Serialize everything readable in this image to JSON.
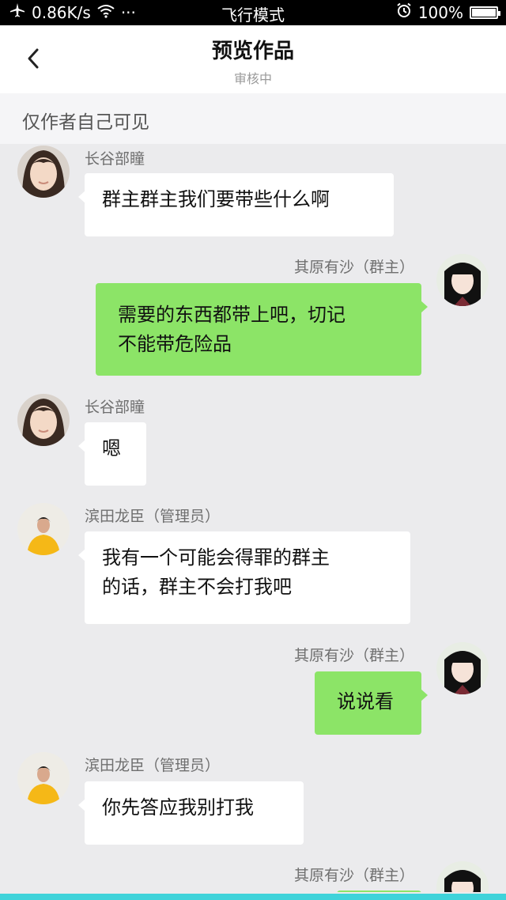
{
  "status_bar": {
    "speed": "0.86K/s",
    "dots": "···",
    "mode": "飞行模式",
    "battery": "100%",
    "battery_level": 1.0
  },
  "header": {
    "title": "预览作品",
    "subtitle": "审核中"
  },
  "notice": "仅作者自己可见",
  "messages": [
    {
      "side": "left",
      "sender": "长谷部瞳",
      "avatar": "woman-short-hair-avatar",
      "text": "群主群主我们要带些什么啊"
    },
    {
      "side": "right",
      "sender": "其原有沙（群主）",
      "avatar": "girl-black-hair-avatar",
      "text": "需要的东西都带上吧，切记\n不能带危险品"
    },
    {
      "side": "left",
      "sender": "长谷部瞳",
      "avatar": "woman-short-hair-avatar",
      "text": "嗯"
    },
    {
      "side": "left",
      "sender": "滨田龙臣（管理员）",
      "avatar": "man-yellow-shirt-avatar",
      "text": "我有一个可能会得罪的群主\n的话，群主不会打我吧"
    },
    {
      "side": "right",
      "sender": "其原有沙（群主）",
      "avatar": "girl-black-hair-avatar",
      "text": "说说看"
    },
    {
      "side": "left",
      "sender": "滨田龙臣（管理员）",
      "avatar": "man-yellow-shirt-avatar",
      "text": "你先答应我别打我"
    },
    {
      "side": "right",
      "sender": "其原有沙（群主）",
      "avatar": "girl-black-hair-avatar",
      "text": ""
    }
  ],
  "colors": {
    "bubble_right": "#8ce467",
    "bubble_left": "#ffffff",
    "background": "#ebebed",
    "bottom_accent": "#3fd3da"
  }
}
